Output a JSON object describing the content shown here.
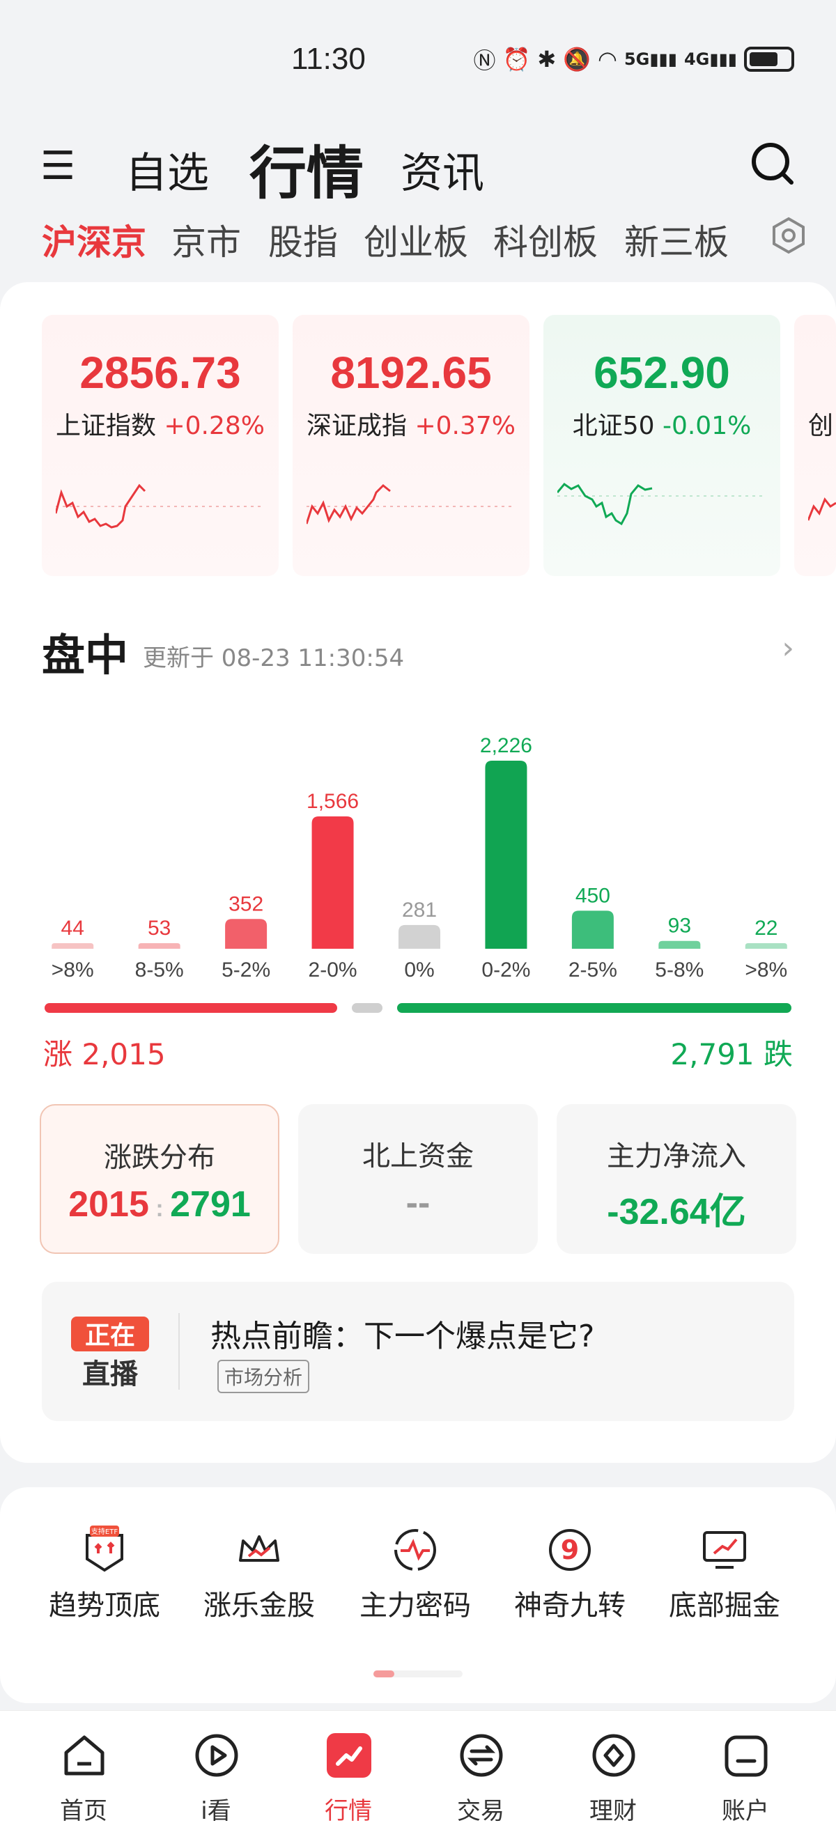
{
  "status": {
    "time": "11:30",
    "icons": [
      "nfc-icon",
      "alarm-icon",
      "bluetooth-icon",
      "mute-icon",
      "wifi-icon",
      "signal-5g-icon",
      "signal-4g-icon",
      "battery-icon"
    ],
    "net_5g": "5G",
    "net_4g": "4G"
  },
  "topnav": {
    "tabs": [
      {
        "label": "自选"
      },
      {
        "label": "行情"
      },
      {
        "label": "资讯"
      }
    ],
    "active": "行情"
  },
  "market_tabs": [
    {
      "label": "沪深京"
    },
    {
      "label": "京市"
    },
    {
      "label": "股指"
    },
    {
      "label": "创业板"
    },
    {
      "label": "科创板"
    },
    {
      "label": "新三板"
    }
  ],
  "indices": [
    {
      "value": "2856.73",
      "name": "上证指数",
      "change": "+0.28%",
      "trend": "up"
    },
    {
      "value": "8192.65",
      "name": "深证成指",
      "change": "+0.37%",
      "trend": "up"
    },
    {
      "value": "652.90",
      "name": "北证50",
      "change": "-0.01%",
      "trend": "down"
    },
    {
      "value": "",
      "name": "创",
      "change": "",
      "trend": "up"
    }
  ],
  "intraday": {
    "title": "盘中",
    "updated": "更新于 08-23 11:30:54"
  },
  "chart_data": {
    "type": "bar",
    "categories": [
      ">8%",
      "8-5%",
      "5-2%",
      "2-0%",
      "0%",
      "0-2%",
      "2-5%",
      "5-8%",
      ">8%"
    ],
    "values": [
      44,
      53,
      352,
      1566,
      281,
      2226,
      450,
      93,
      22
    ],
    "value_labels": [
      "44",
      "53",
      "352",
      "1,566",
      "281",
      "2,226",
      "450",
      "93",
      "22"
    ],
    "colors": [
      "#f6c3c3",
      "#f7b3b5",
      "#f2606a",
      "#f23a48",
      "#d2d2d2",
      "#11a452",
      "#3dbe7b",
      "#6fd19c",
      "#a9e1c3"
    ],
    "label_colors": [
      "#e8383d",
      "#e8383d",
      "#e8383d",
      "#e8383d",
      "#999999",
      "#10a955",
      "#10a955",
      "#10a955",
      "#10a955"
    ]
  },
  "rise_fall": {
    "rise": "涨 2,015",
    "fall": "2,791 跌"
  },
  "stats": [
    {
      "title": "涨跌分布",
      "value_up": "2015",
      "value_down": "2791"
    },
    {
      "title": "北上资金",
      "value": "--"
    },
    {
      "title": "主力净流入",
      "value": "-32.64亿"
    }
  ],
  "live": {
    "badge_top": "正在",
    "badge_bottom": "直播",
    "title": "热点前瞻：下一个爆点是它?",
    "tag": "市场分析"
  },
  "tools": [
    {
      "label": "趋势顶底",
      "icon": "etf-trend-icon",
      "badge": "支持ETF"
    },
    {
      "label": "涨乐金股",
      "icon": "crown-icon"
    },
    {
      "label": "主力密码",
      "icon": "pulse-icon"
    },
    {
      "label": "神奇九转",
      "icon": "nine-icon"
    },
    {
      "label": "底部掘金",
      "icon": "monitor-chart-icon"
    }
  ],
  "bottom_nav": [
    {
      "label": "首页",
      "icon": "home-icon"
    },
    {
      "label": "i看",
      "icon": "play-icon"
    },
    {
      "label": "行情",
      "icon": "market-icon"
    },
    {
      "label": "交易",
      "icon": "exchange-icon"
    },
    {
      "label": "理财",
      "icon": "diamond-icon"
    },
    {
      "label": "账户",
      "icon": "account-icon"
    }
  ],
  "colors": {
    "up": "#e8383d",
    "down": "#10a955",
    "accent": "#e8383d"
  }
}
